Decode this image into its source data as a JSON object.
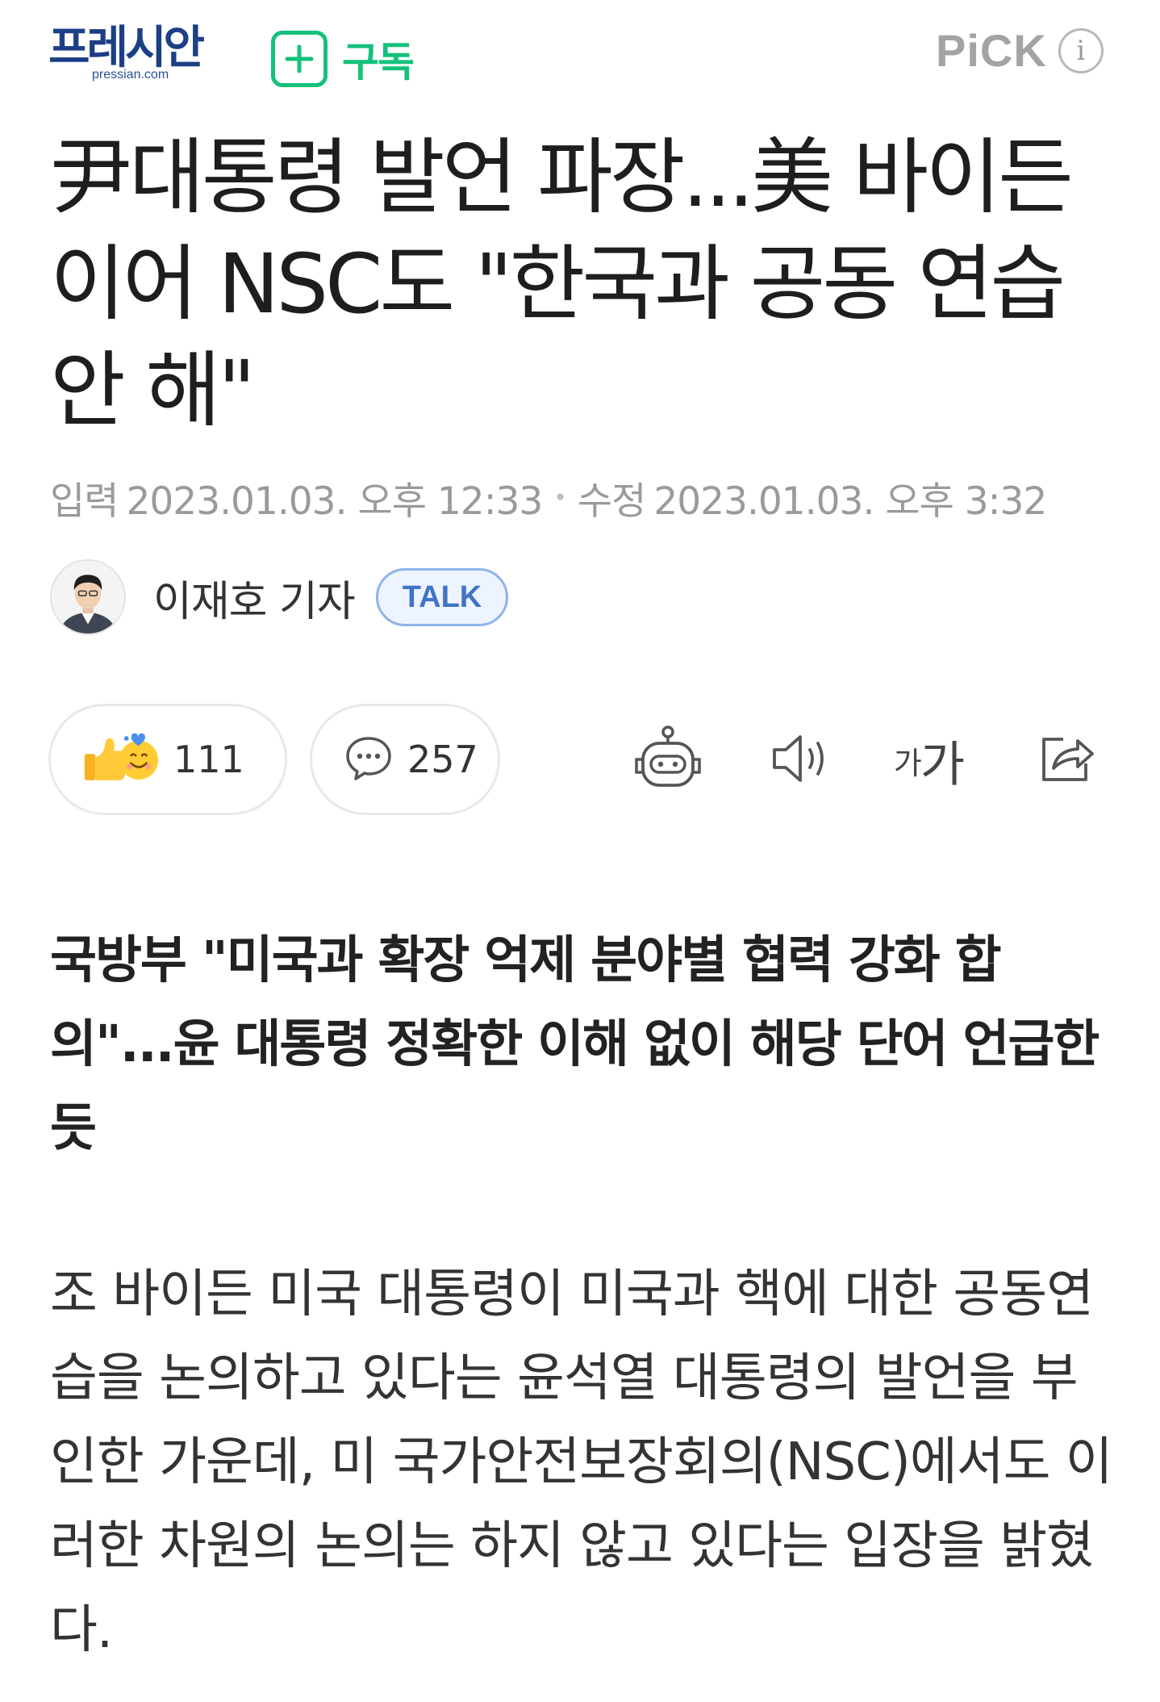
{
  "header": {
    "logo_text": "프레시안",
    "logo_sub": "pressian.com",
    "subscribe_label": "구독",
    "pick_label": "PiCK",
    "info_glyph": "i",
    "accent_color": "#14c17b",
    "brand_color": "#1c3f86"
  },
  "article": {
    "title": "尹대통령 발언 파장...美 바이든 이어 NSC도 \"한국과 공동 연습 안 해\"",
    "published_label": "입력",
    "published": "2023.01.03. 오후 12:33",
    "modified_label": "수정",
    "modified": "2023.01.03. 오후 3:32",
    "author": "이재호 기자",
    "talk_label": "TALK",
    "reactions_count": "111",
    "comments_count": "257",
    "font_button": {
      "small": "가",
      "large": "가"
    },
    "subtitle": "국방부 \"미국과 확장 억제 분야별 협력 강화 합의\"...윤 대통령 정확한 이해 없이 해당 단어 언급한 듯",
    "body": "조 바이든 미국 대통령이 미국과 핵에 대한 공동연습을 논의하고 있다는 윤석열 대통령의 발언을 부인한 가운데, 미 국가안전보장회의(NSC)에서도 이러한 차원의 논의는 하지 않고 있다는 입장을 밝혔다."
  },
  "icons": {
    "subscribe": "plus-icon",
    "info": "info-icon",
    "reaction": "thumbs-up-emoji-icon",
    "comment": "speech-bubble-icon",
    "summary_bot": "robot-icon",
    "tts": "speaker-icon",
    "share": "share-icon"
  }
}
